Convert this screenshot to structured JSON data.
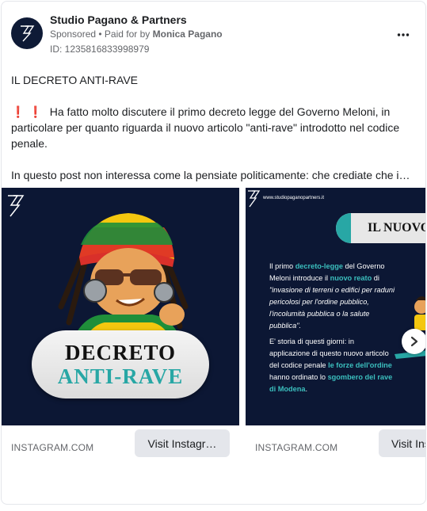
{
  "ad": {
    "page_name": "Studio Pagano & Partners",
    "sponsored": "Sponsored",
    "separator": " • ",
    "paid_for_prefix": "Paid for by ",
    "paid_for_name": "Monica Pagano",
    "ad_id": "ID: 1235816833998979",
    "more_icon": "more-horizontal-icon"
  },
  "body": {
    "heading": "IL DECRETO ANTI-RAVE",
    "emoji": "❗❗",
    "paragraph1": " Ha fatto molto discutere il primo decreto legge del Governo Meloni, in particolare per quanto riguarda il nuovo articolo \"anti-rave\" introdotto nel codice penale.",
    "paragraph2": "In questo post non interessa come la pensiate politicamente: che crediate che i…"
  },
  "carousel": {
    "cards": [
      {
        "title_line1": "DECRETO",
        "title_line2": "ANTI-RAVE",
        "domain": "INSTAGRAM.COM",
        "cta": "Visit Instagr…"
      },
      {
        "watermark": "www.studiopaganopartners.it",
        "title": "IL NUOVO",
        "p1_a": "Il primo ",
        "p1_hl1": "decreto-legge",
        "p1_b": " del Governo Meloni introduce il ",
        "p1_hl2": "nuovo reato",
        "p1_c": " di ",
        "p1_italic": "\"invasione di terreni o edifici per raduni pericolosi per l'ordine pubblico, l'incolumità pubblica o la salute pubblica\".",
        "p2_a": "E' storia di questi giorni: in applicazione di questo nuovo articolo del codice penale ",
        "p2_hl1": "le forze dell'ordine",
        "p2_b": " hanno ordinato lo ",
        "p2_hl2": "sgombero del rave di Modena",
        "p2_c": ".",
        "domain": "INSTAGRAM.COM",
        "cta": "Visit Ins"
      }
    ],
    "next_icon": "chevron-right-icon"
  },
  "colors": {
    "card_bg": "#0c1734",
    "accent_teal": "#28a7a5",
    "emoji_red": "#e0245e"
  }
}
